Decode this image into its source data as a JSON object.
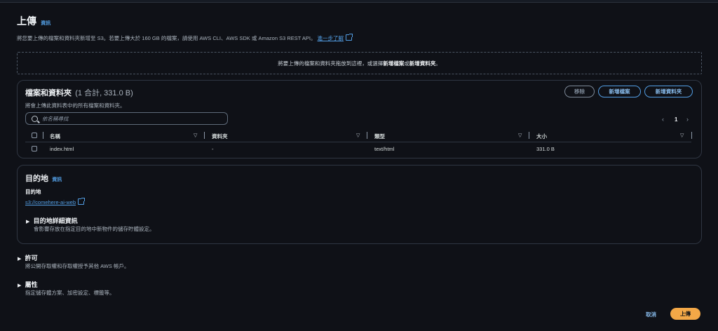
{
  "header": {
    "title": "上傳",
    "info": "資訊",
    "description": "將您要上傳的檔案和資料夾新增至 S3。若要上傳大於 160 GB 的檔案，請使用 AWS CLI、AWS SDK 或 Amazon S3 REST API。",
    "learn_more": "進一步了解"
  },
  "dropzone": {
    "prefix": "將要上傳的檔案和資料夾拖放到這裡，或選擇",
    "add_files": "新增檔案",
    "or": "或",
    "add_folder": "新增資料夾",
    "suffix": "。"
  },
  "files_panel": {
    "title": "檔案和資料夾",
    "count": "(1 合計, 331.0 B)",
    "subtitle": "將會上傳此資料表中的所有檔案和資料夾。",
    "remove_label": "移除",
    "add_files_label": "新增檔案",
    "add_folder_label": "新增資料夾",
    "search_placeholder": "依名稱尋找",
    "page": "1",
    "columns": [
      "名稱",
      "資料夾",
      "類型",
      "大小"
    ],
    "rows": [
      {
        "name": "index.html",
        "folder": "-",
        "type": "text/html",
        "size": "331.0 B"
      }
    ]
  },
  "destination": {
    "title": "目的地",
    "info": "資訊",
    "label": "目的地",
    "bucket": "s3://comehere-ai-web",
    "details_title": "目的地詳細資訊",
    "details_sub": "會影響存放在指定目的地中新物件的儲存貯體設定。"
  },
  "permissions": {
    "title": "許可",
    "sub": "將公開存取權和存取權授予其他 AWS 帳戶。"
  },
  "properties": {
    "title": "屬性",
    "sub": "指定儲存體方案、加密設定、標籤等。"
  },
  "footer": {
    "cancel": "取消",
    "upload": "上傳"
  }
}
